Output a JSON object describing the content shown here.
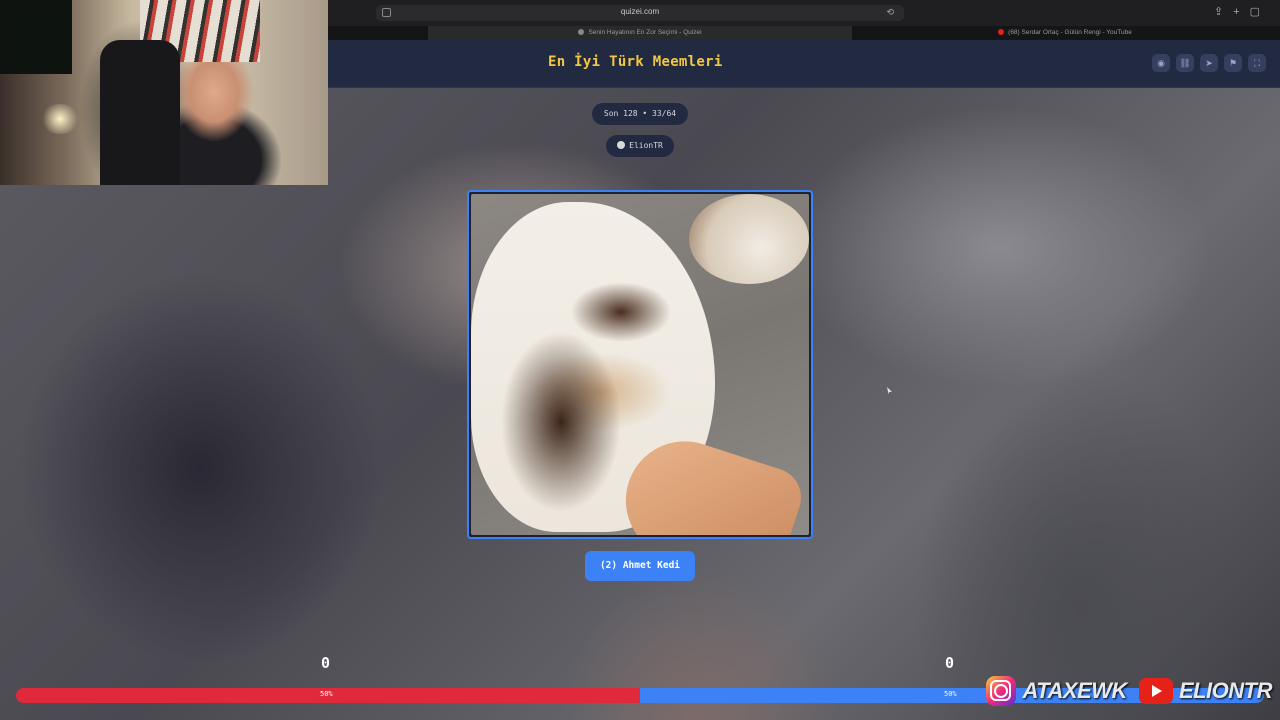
{
  "browser": {
    "url": "quizei.com",
    "tabs": [
      {
        "label": "Senin Hayatının En Zor Seçimi - Quizei"
      },
      {
        "label": "(68) Serdar Ortaç - Gülün Rengi - YouTube"
      }
    ]
  },
  "header": {
    "title": "En İyi Türk Meemleri"
  },
  "meta": {
    "round": "Son 128 • 33/64",
    "author": "ElionTR"
  },
  "option": {
    "label": "(2) Ahmet Kedi"
  },
  "scores": {
    "left": "0",
    "right": "0"
  },
  "vote": {
    "left_pct": "50%",
    "right_pct": "50%",
    "left_fraction": 0.5
  },
  "overlay": {
    "instagram": "ATAXEWK",
    "youtube": "ELIONTR"
  },
  "colors": {
    "accent_yellow": "#f2c744",
    "blue": "#3c82f6",
    "red": "#e02a3c",
    "header_bg": "#222a42"
  }
}
